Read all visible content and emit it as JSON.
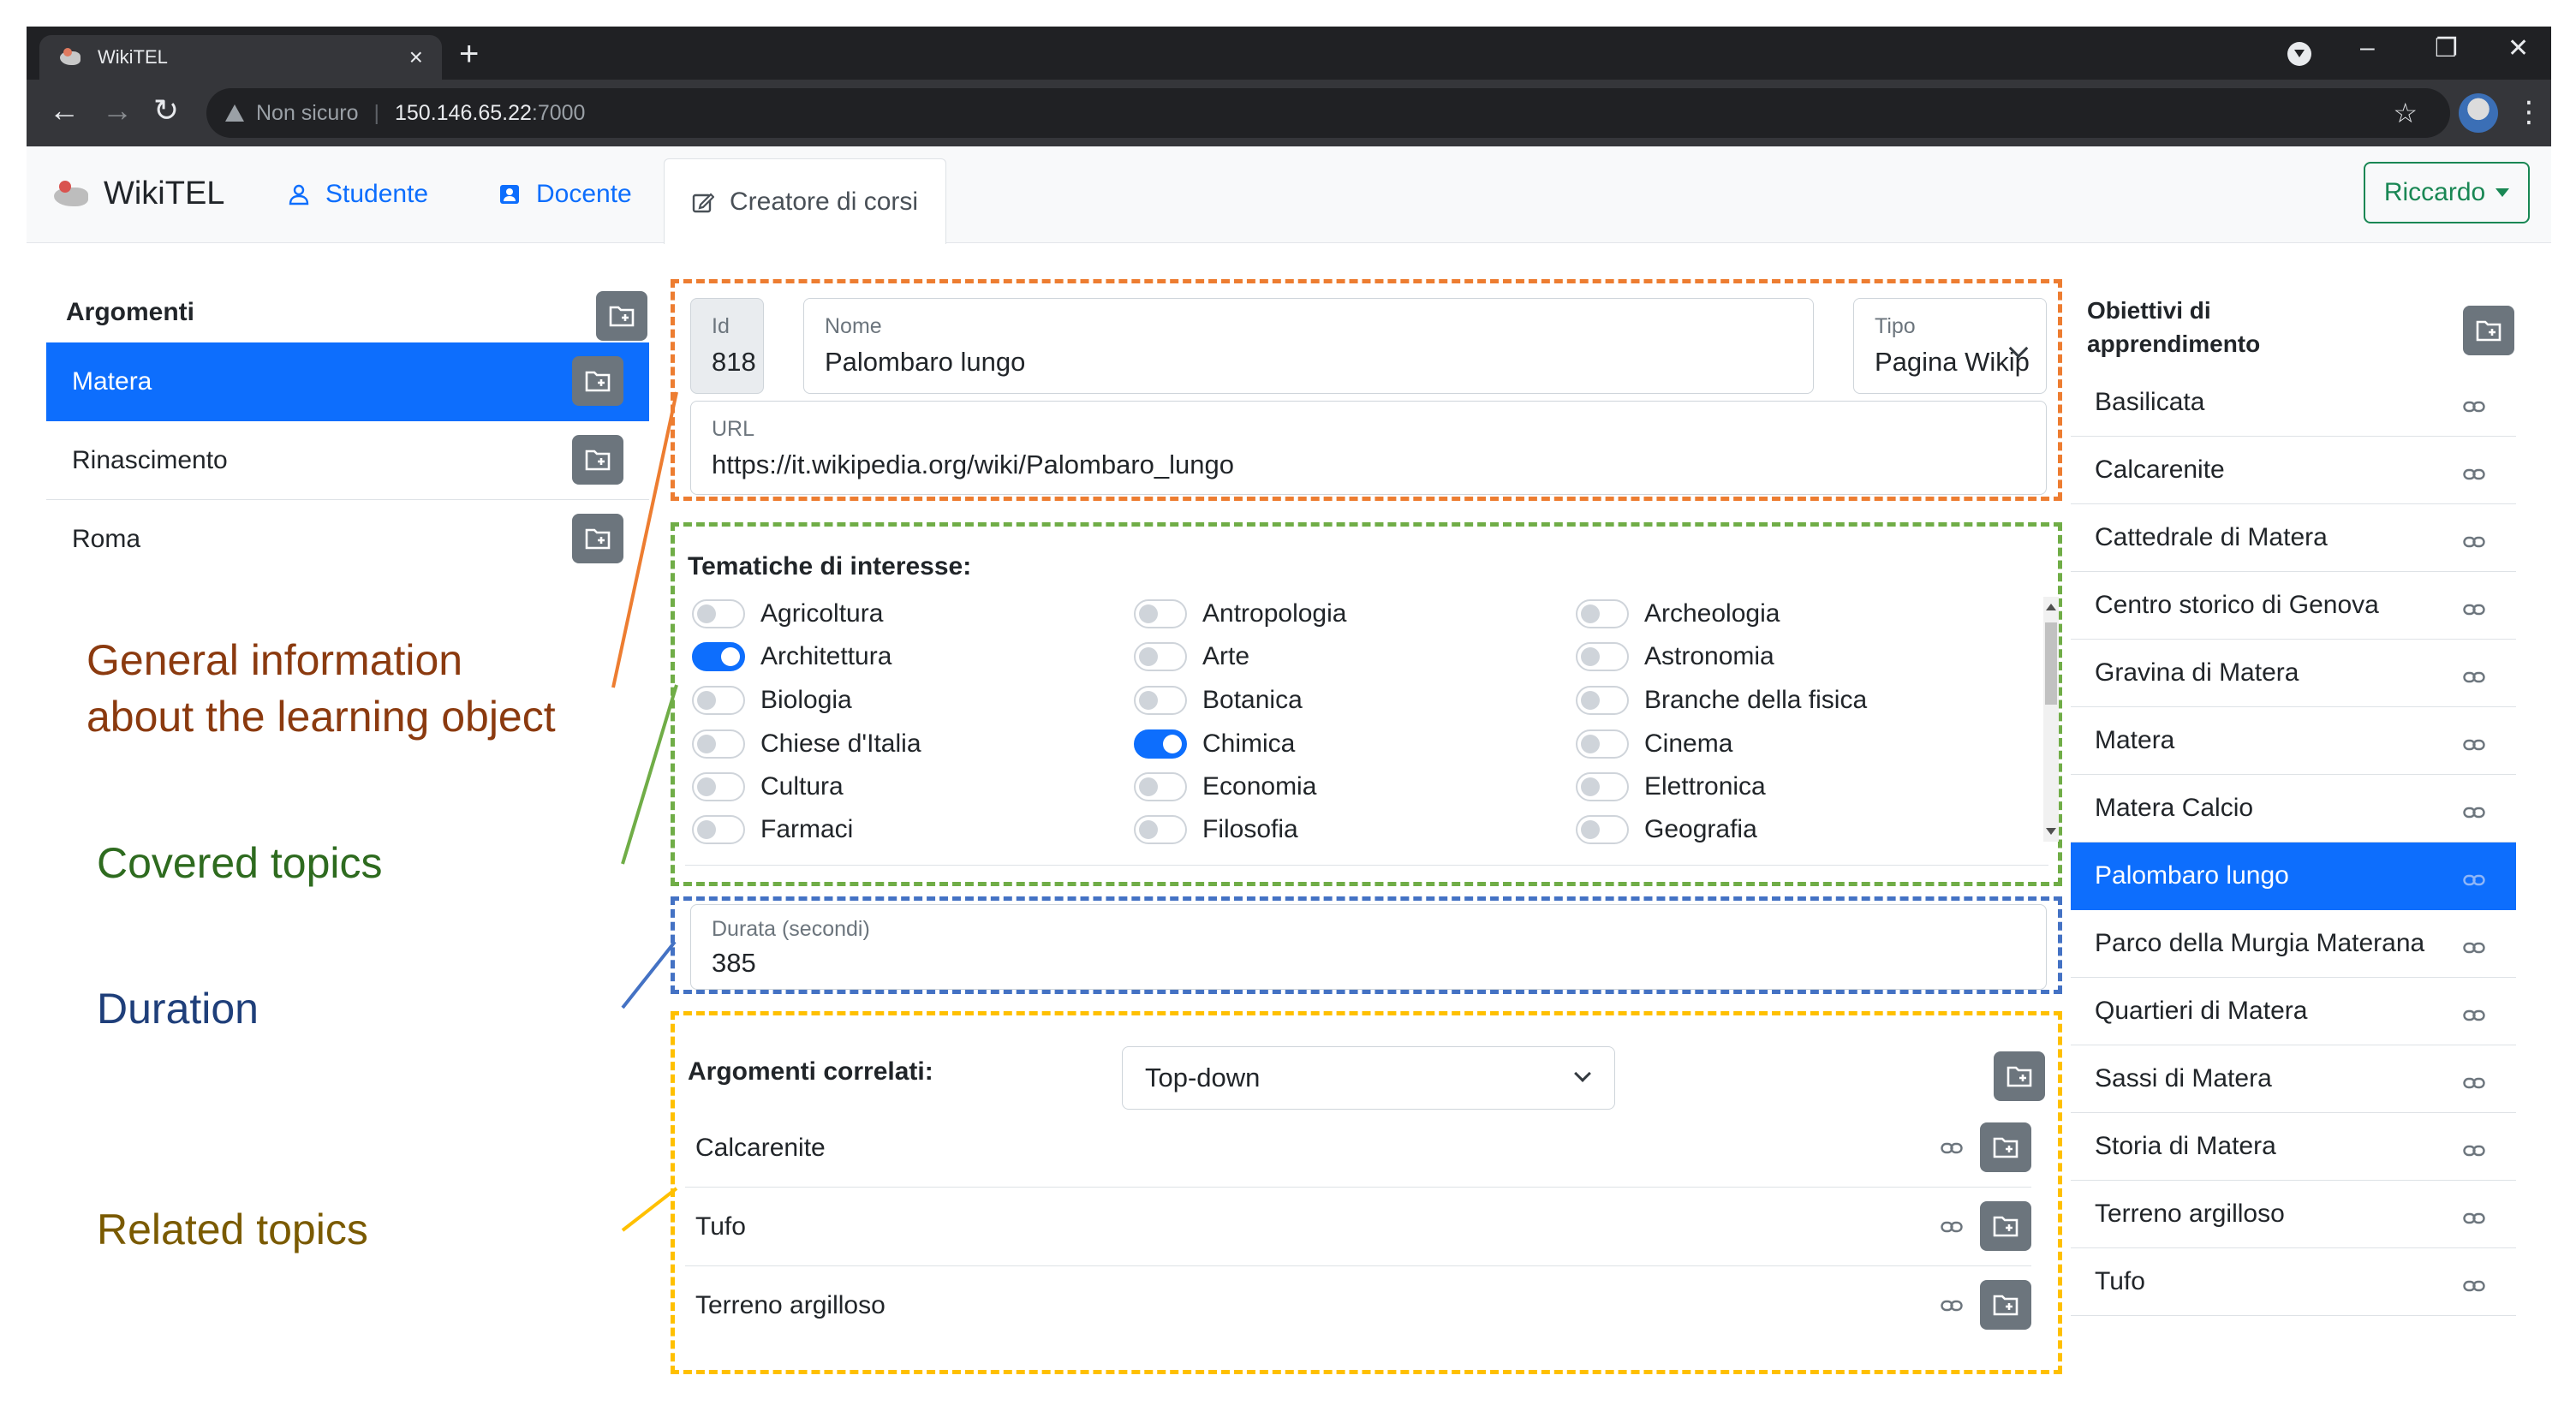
{
  "browser": {
    "tab_title": "WikiTEL",
    "tab_close": "×",
    "new_tab": "+",
    "security_label": "Non sicuro",
    "url_host": "150.146.65.22",
    "url_port": ":7000",
    "window_controls": [
      "–",
      "❐",
      "✕"
    ]
  },
  "app": {
    "brand": "WikiTEL",
    "nav": [
      {
        "label": "Studente",
        "icon": "person-icon"
      },
      {
        "label": "Docente",
        "icon": "person-badge-icon"
      },
      {
        "label": "Creatore di corsi",
        "icon": "pencil-square-icon",
        "active": true
      }
    ],
    "user": "Riccardo"
  },
  "left": {
    "title": "Argomenti",
    "items": [
      {
        "label": "Matera",
        "active": true
      },
      {
        "label": "Rinascimento",
        "active": false
      },
      {
        "label": "Roma",
        "active": false
      }
    ]
  },
  "annotations": {
    "general_1": "General information",
    "general_2": "about the learning object",
    "covered": "Covered topics",
    "duration": "Duration",
    "related": "Related topics",
    "colors": {
      "general": "#8B3A0F",
      "covered": "#2E6B1F",
      "duration": "#1F3F7A",
      "related": "#7A5A00",
      "box_orange": "#ED7D31",
      "box_green": "#70AD47",
      "box_blue": "#4472C4",
      "box_yellow": "#FFC000"
    }
  },
  "form": {
    "id_label": "Id",
    "id_value": "818",
    "name_label": "Nome",
    "name_value": "Palombaro lungo",
    "type_label": "Tipo",
    "type_value": "Pagina Wikip",
    "url_label": "URL",
    "url_value": "https://it.wikipedia.org/wiki/Palombaro_lungo",
    "duration_label": "Durata (secondi)",
    "duration_value": "385"
  },
  "topics": {
    "title": "Tematiche di interesse:",
    "items": [
      {
        "label": "Agricoltura",
        "on": false
      },
      {
        "label": "Antropologia",
        "on": false
      },
      {
        "label": "Archeologia",
        "on": false
      },
      {
        "label": "Architettura",
        "on": true
      },
      {
        "label": "Arte",
        "on": false
      },
      {
        "label": "Astronomia",
        "on": false
      },
      {
        "label": "Biologia",
        "on": false
      },
      {
        "label": "Botanica",
        "on": false
      },
      {
        "label": "Branche della fisica",
        "on": false
      },
      {
        "label": "Chiese d'Italia",
        "on": false
      },
      {
        "label": "Chimica",
        "on": true
      },
      {
        "label": "Cinema",
        "on": false
      },
      {
        "label": "Cultura",
        "on": false
      },
      {
        "label": "Economia",
        "on": false
      },
      {
        "label": "Elettronica",
        "on": false
      },
      {
        "label": "Farmaci",
        "on": false
      },
      {
        "label": "Filosofia",
        "on": false
      },
      {
        "label": "Geografia",
        "on": false
      }
    ]
  },
  "related": {
    "title": "Argomenti correlati:",
    "mode": "Top-down",
    "items": [
      "Calcarenite",
      "Tufo",
      "Terreno argilloso"
    ]
  },
  "right": {
    "title_1": "Obiettivi di",
    "title_2": "apprendimento",
    "items": [
      {
        "label": "Basilicata",
        "active": false
      },
      {
        "label": "Calcarenite",
        "active": false
      },
      {
        "label": "Cattedrale di Matera",
        "active": false
      },
      {
        "label": "Centro storico di Genova",
        "active": false
      },
      {
        "label": "Gravina di Matera",
        "active": false
      },
      {
        "label": "Matera",
        "active": false
      },
      {
        "label": "Matera Calcio",
        "active": false
      },
      {
        "label": "Palombaro lungo",
        "active": true
      },
      {
        "label": "Parco della Murgia Materana",
        "active": false
      },
      {
        "label": "Quartieri di Matera",
        "active": false
      },
      {
        "label": "Sassi di Matera",
        "active": false
      },
      {
        "label": "Storia di Matera",
        "active": false
      },
      {
        "label": "Terreno argilloso",
        "active": false
      },
      {
        "label": "Tufo",
        "active": false
      }
    ]
  }
}
